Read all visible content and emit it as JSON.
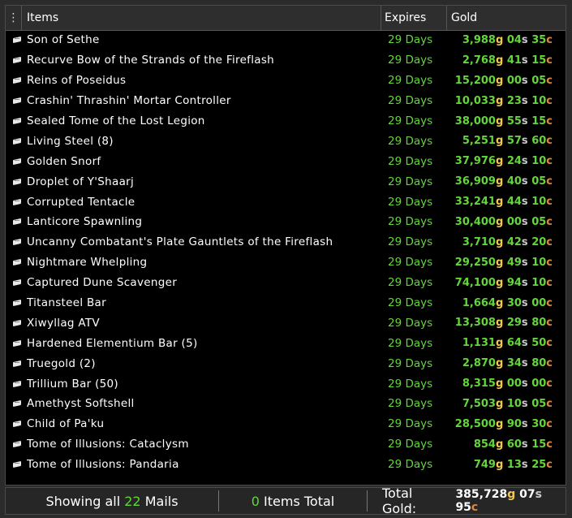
{
  "header": {
    "menu_icon": "vertical-dots-icon",
    "items": "Items",
    "expires": "Expires",
    "gold": "Gold"
  },
  "rows": [
    {
      "name": "Son of Sethe",
      "expires": "29 Days",
      "g": "3,988",
      "s": "04",
      "c": "35"
    },
    {
      "name": "Recurve Bow of the Strands of the Fireflash",
      "expires": "29 Days",
      "g": "2,768",
      "s": "41",
      "c": "15"
    },
    {
      "name": "Reins of Poseidus",
      "expires": "29 Days",
      "g": "15,200",
      "s": "00",
      "c": "05"
    },
    {
      "name": "Crashin' Thrashin' Mortar Controller",
      "expires": "29 Days",
      "g": "10,033",
      "s": "23",
      "c": "10"
    },
    {
      "name": "Sealed Tome of the Lost Legion",
      "expires": "29 Days",
      "g": "38,000",
      "s": "55",
      "c": "15"
    },
    {
      "name": "Living Steel (8)",
      "expires": "29 Days",
      "g": "5,251",
      "s": "57",
      "c": "60"
    },
    {
      "name": "Golden Snorf",
      "expires": "29 Days",
      "g": "37,976",
      "s": "24",
      "c": "10"
    },
    {
      "name": "Droplet of Y'Shaarj",
      "expires": "29 Days",
      "g": "36,909",
      "s": "40",
      "c": "05"
    },
    {
      "name": "Corrupted Tentacle",
      "expires": "29 Days",
      "g": "33,241",
      "s": "44",
      "c": "10"
    },
    {
      "name": "Lanticore Spawnling",
      "expires": "29 Days",
      "g": "30,400",
      "s": "00",
      "c": "05"
    },
    {
      "name": "Uncanny Combatant's Plate Gauntlets of the Fireflash",
      "expires": "29 Days",
      "g": "3,710",
      "s": "42",
      "c": "20"
    },
    {
      "name": "Nightmare Whelpling",
      "expires": "29 Days",
      "g": "29,250",
      "s": "49",
      "c": "10"
    },
    {
      "name": "Captured Dune Scavenger",
      "expires": "29 Days",
      "g": "74,100",
      "s": "94",
      "c": "10"
    },
    {
      "name": "Titansteel Bar",
      "expires": "29 Days",
      "g": "1,664",
      "s": "30",
      "c": "00"
    },
    {
      "name": "Xiwyllag ATV",
      "expires": "29 Days",
      "g": "13,308",
      "s": "29",
      "c": "80"
    },
    {
      "name": "Hardened Elementium Bar (5)",
      "expires": "29 Days",
      "g": "1,131",
      "s": "64",
      "c": "50"
    },
    {
      "name": "Truegold (2)",
      "expires": "29 Days",
      "g": "2,870",
      "s": "34",
      "c": "80"
    },
    {
      "name": "Trillium Bar (50)",
      "expires": "29 Days",
      "g": "8,315",
      "s": "00",
      "c": "00"
    },
    {
      "name": "Amethyst Softshell",
      "expires": "29 Days",
      "g": "7,503",
      "s": "10",
      "c": "05"
    },
    {
      "name": "Child of Pa'ku",
      "expires": "29 Days",
      "g": "28,500",
      "s": "90",
      "c": "30"
    },
    {
      "name": "Tome of Illusions: Cataclysm",
      "expires": "29 Days",
      "g": "854",
      "s": "60",
      "c": "15"
    },
    {
      "name": "Tome of Illusions: Pandaria",
      "expires": "29 Days",
      "g": "749",
      "s": "13",
      "c": "25"
    }
  ],
  "units": {
    "g": "g",
    "s": "s",
    "c": "c"
  },
  "row_icon": "mail-icon",
  "footer": {
    "showing_prefix": "Showing all",
    "mail_count": "22",
    "showing_suffix": "Mails",
    "items_count": "0",
    "items_label": "Items Total",
    "total_label": "Total Gold:",
    "total_g": "385,728",
    "total_s": "07",
    "total_c": "95"
  },
  "colors": {
    "green": "#63d63a",
    "gold": "#f2c94c",
    "silver": "#c9c9c9",
    "copper": "#e0893a"
  }
}
